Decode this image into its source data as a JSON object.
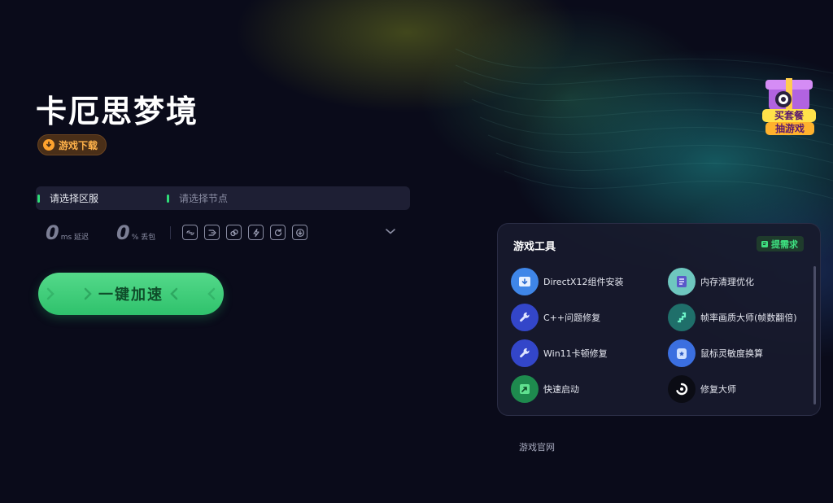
{
  "game": {
    "title": "卡厄思梦境",
    "download_label": "游戏下载"
  },
  "region": {
    "server_label": "请选择区服",
    "node_placeholder": "请选择节点"
  },
  "stats": {
    "latency_value": "0",
    "latency_unit": "ms 延迟",
    "loss_value": "0",
    "loss_unit": "% 丢包"
  },
  "quick_tools": [
    "link-icon",
    "route-icon",
    "multi-link-icon",
    "boost-icon",
    "refresh-icon",
    "download-icon"
  ],
  "accelerate_label": "一键加速",
  "promo": {
    "line1": "买套餐",
    "line2": "抽游戏"
  },
  "tools_panel": {
    "title": "游戏工具",
    "request_label": "提需求",
    "items": [
      {
        "label": "DirectX12组件安装",
        "icon": "directx-icon"
      },
      {
        "label": "内存清理优化",
        "icon": "memory-clean-icon"
      },
      {
        "label": "C++问题修复",
        "icon": "wrench-icon"
      },
      {
        "label": "帧率画质大师(帧数翻倍)",
        "icon": "frame-rate-icon"
      },
      {
        "label": "Win11卡顿修复",
        "icon": "wrench-icon"
      },
      {
        "label": "鼠标灵敏度换算",
        "icon": "mouse-sensitivity-icon"
      },
      {
        "label": "快速启动",
        "icon": "quick-launch-icon"
      },
      {
        "label": "修复大师",
        "icon": "repair-master-icon"
      }
    ]
  },
  "official_site_label": "游戏官网",
  "colors": {
    "background": "#0a0b1a",
    "accent_green": "#3ee080",
    "download_orange": "#ffb24a",
    "panel_bg": "#181a2c"
  }
}
